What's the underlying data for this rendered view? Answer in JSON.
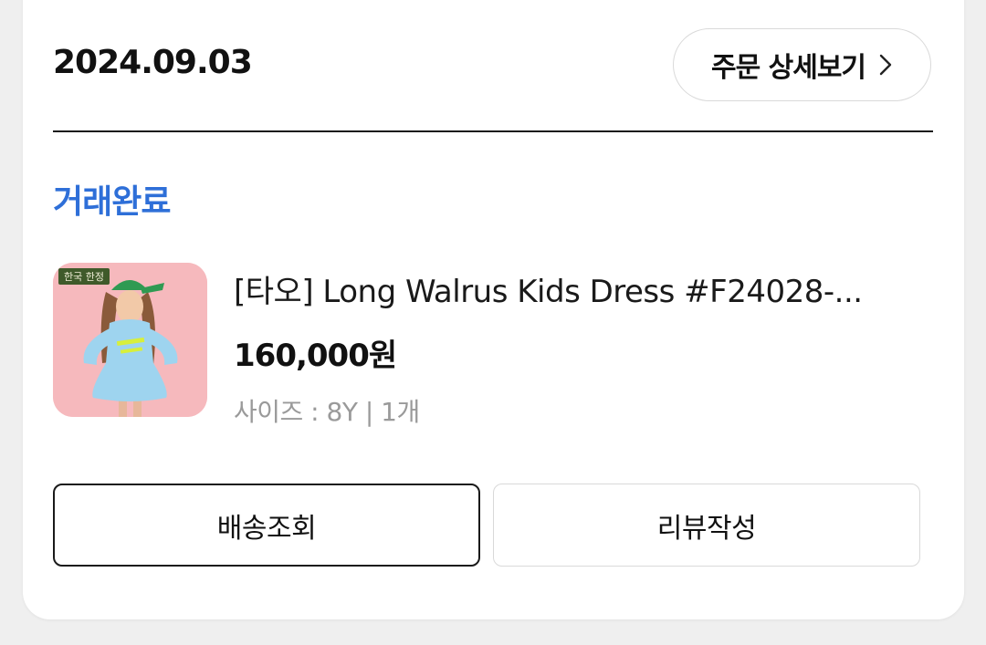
{
  "order": {
    "date": "2024.09.03",
    "detail_button_label": "주문 상세보기",
    "detail_button_icon": "chevron-right-icon",
    "status": "거래완료",
    "status_color": "#2e6fd8"
  },
  "product": {
    "image_tag": "한국 한정",
    "title": "[타오] Long Walrus Kids Dress #F24028-...",
    "price": "160,000원",
    "options": "사이즈 : 8Y | 1개"
  },
  "actions": {
    "track_label": "배송조회",
    "review_label": "리뷰작성"
  }
}
